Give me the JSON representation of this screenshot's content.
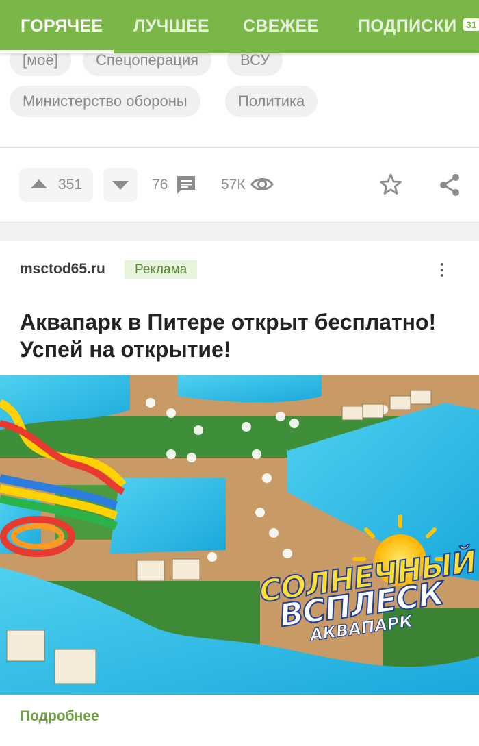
{
  "nav": {
    "tabs": [
      {
        "label": "ГОРЯЧЕЕ",
        "active": true
      },
      {
        "label": "ЛУЧШЕЕ"
      },
      {
        "label": "СВЕЖЕЕ"
      },
      {
        "label": "ПОДПИСКИ"
      }
    ],
    "badge": "31",
    "accent_color": "#7ab648"
  },
  "post": {
    "tags": [
      "[моё]",
      "Спецоперация",
      "ВСУ",
      "Министерство обороны",
      "Политика"
    ],
    "rating_up": "351",
    "comments_count": "76",
    "views_count": "57К",
    "icons": [
      "upvote-arrow",
      "downvote-arrow",
      "comment-icon",
      "eye-icon",
      "star-icon",
      "share-icon"
    ]
  },
  "ad": {
    "source": "msctod65.ru",
    "badge": "Реклама",
    "title": "Аквапарк в Питере открыт бесплатно! Успей на открытие!",
    "image_logo": {
      "line1": "СОЛНЕЧНЫЙ",
      "line2": "ВСПЛЕСК",
      "line3": "АКВАПАРК"
    },
    "more_label": "Подробнее"
  }
}
